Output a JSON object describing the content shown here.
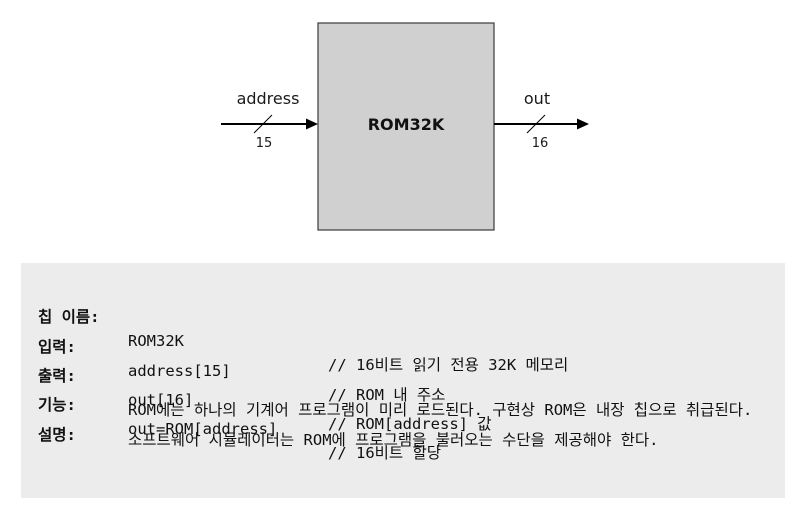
{
  "diagram": {
    "chip_name": "ROM32K",
    "input_label": "address",
    "input_width": "15",
    "output_label": "out",
    "output_width": "16",
    "box_color": "#d0d0d0"
  },
  "spec": {
    "rows": [
      {
        "key": "칩 이름:",
        "value": "ROM32K",
        "comment": "// 16비트 읽기 전용 32K 메모리"
      },
      {
        "key": "입력:",
        "value": "address[15]",
        "comment": "// ROM 내 주소"
      },
      {
        "key": "출력:",
        "value": "out[16]",
        "comment": "// ROM[address] 값"
      },
      {
        "key": "기능:",
        "value": "out=ROM[address]",
        "comment": "// 16비트 할당"
      }
    ],
    "desc_key": "설명:",
    "desc_text": "ROM에는 하나의 기계어 프로그램이 미리 로드된다. 구현상 ROM은 내장 칩으로 취급된다. 소프트웨어 시뮬레이터는 ROM에 프로그램을 불러오는 수단을 제공해야 한다.",
    "background": "#ececec"
  }
}
